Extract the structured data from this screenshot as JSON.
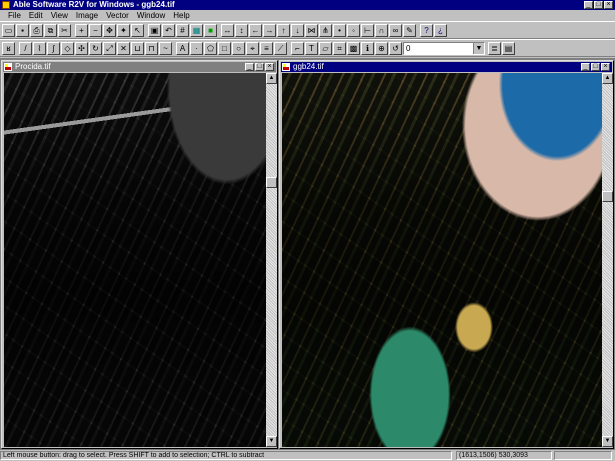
{
  "app": {
    "title": "Able Software R2V for Windows - ggb24.tif"
  },
  "menu": {
    "items": [
      "File",
      "Edit",
      "View",
      "Image",
      "Vector",
      "Window",
      "Help"
    ]
  },
  "toolbar1": {
    "buttons": [
      {
        "name": "new-icon",
        "glyph": "▭"
      },
      {
        "name": "save-icon",
        "glyph": "▪"
      },
      {
        "name": "print-icon",
        "glyph": "⎙"
      },
      {
        "name": "copy-icon",
        "glyph": "⧉"
      },
      {
        "name": "cut-icon",
        "glyph": "✂"
      },
      {
        "name": "zoom-in-icon",
        "glyph": "+"
      },
      {
        "name": "zoom-out-icon",
        "glyph": "−"
      },
      {
        "name": "pan-icon",
        "glyph": "✥"
      },
      {
        "name": "magic-wand-icon",
        "glyph": "✦"
      },
      {
        "name": "select-arrow-icon",
        "glyph": "↖"
      },
      {
        "name": "display-icon",
        "glyph": "▣"
      },
      {
        "name": "undo-icon",
        "glyph": "↶"
      },
      {
        "name": "grid-icon",
        "glyph": "#"
      },
      {
        "name": "raster-icon",
        "glyph": "▦"
      },
      {
        "name": "green-fill-icon",
        "glyph": "■"
      },
      {
        "name": "line-h-icon",
        "glyph": "↔"
      },
      {
        "name": "line-v-icon",
        "glyph": "↕"
      },
      {
        "name": "arrow-left-icon",
        "glyph": "←"
      },
      {
        "name": "arrow-right-icon",
        "glyph": "→"
      },
      {
        "name": "arrow-up-icon",
        "glyph": "↑"
      },
      {
        "name": "arrow-down-icon",
        "glyph": "↓"
      },
      {
        "name": "merge-icon",
        "glyph": "⋈"
      },
      {
        "name": "split-icon",
        "glyph": "⋔"
      },
      {
        "name": "node-icon",
        "glyph": "•"
      },
      {
        "name": "vertex-icon",
        "glyph": "◦"
      },
      {
        "name": "measure-icon",
        "glyph": "⊢"
      },
      {
        "name": "magnet-icon",
        "glyph": "∩"
      },
      {
        "name": "link-icon",
        "glyph": "∞"
      },
      {
        "name": "pen-icon",
        "glyph": "✎"
      },
      {
        "name": "help-icon",
        "glyph": "?"
      },
      {
        "name": "context-help-icon",
        "glyph": "¿"
      }
    ]
  },
  "toolbar2": {
    "buttons": [
      {
        "name": "vectorize-icon",
        "glyph": "ʁ"
      },
      {
        "name": "draw-line-icon",
        "glyph": "/"
      },
      {
        "name": "draw-polyline-icon",
        "glyph": "⌇"
      },
      {
        "name": "draw-curve-icon",
        "glyph": "∫"
      },
      {
        "name": "edit-node-icon",
        "glyph": "◇"
      },
      {
        "name": "move-icon",
        "glyph": "✣"
      },
      {
        "name": "rotate-icon",
        "glyph": "↻"
      },
      {
        "name": "scale-icon",
        "glyph": "⤢"
      },
      {
        "name": "delete-icon",
        "glyph": "✕"
      },
      {
        "name": "join-icon",
        "glyph": "⊔"
      },
      {
        "name": "break-icon",
        "glyph": "⊓"
      },
      {
        "name": "smooth-icon",
        "glyph": "~"
      },
      {
        "name": "label-icon",
        "glyph": "A"
      },
      {
        "name": "point-icon",
        "glyph": "·"
      },
      {
        "name": "polygon-icon",
        "glyph": "⬠"
      },
      {
        "name": "rectangle-icon",
        "glyph": "□"
      },
      {
        "name": "circle-icon",
        "glyph": "○"
      },
      {
        "name": "snap-icon",
        "glyph": "⌖"
      },
      {
        "name": "layer-icon",
        "glyph": "≡"
      },
      {
        "name": "trace-icon",
        "glyph": "⟋"
      },
      {
        "name": "cursor-icon",
        "glyph": "⌐"
      },
      {
        "name": "text-tool-icon",
        "glyph": "T"
      },
      {
        "name": "area-icon",
        "glyph": "▱"
      },
      {
        "name": "clip-icon",
        "glyph": "⌗"
      },
      {
        "name": "fill-icon",
        "glyph": "▩"
      },
      {
        "name": "attribute-icon",
        "glyph": "ℹ"
      },
      {
        "name": "zoom-window-icon",
        "glyph": "⊕"
      },
      {
        "name": "refresh-icon",
        "glyph": "↺"
      }
    ],
    "layer_select": {
      "value": "0"
    },
    "extra_buttons": [
      {
        "name": "layer-list-icon",
        "glyph": "≣"
      },
      {
        "name": "layer-color-icon",
        "glyph": "▤"
      }
    ]
  },
  "windows": {
    "left": {
      "title": "Procida.tif"
    },
    "right": {
      "title": "ggb24.tif"
    }
  },
  "statusbar": {
    "message": "Left mouse button: drag to select. Press SHIFT to add to selection; CTRL to subtract",
    "coords": "(1613,1506)  530,3093"
  },
  "colors": {
    "titlebar_active": "#000080",
    "titlebar_inactive": "#808080",
    "workspace": "#808080",
    "chrome": "#c0c0c0"
  }
}
